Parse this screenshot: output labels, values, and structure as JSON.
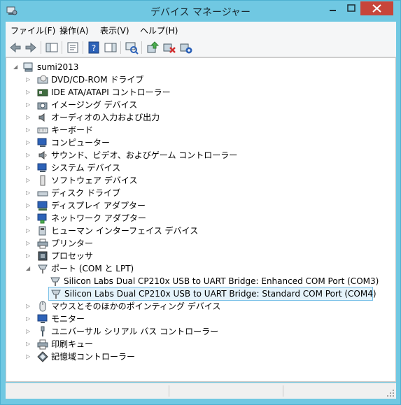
{
  "window": {
    "title": "デバイス マネージャー"
  },
  "menu": [
    {
      "label": "ファイル(F)"
    },
    {
      "label": "操作(A)"
    },
    {
      "label": "表示(V)"
    },
    {
      "label": "ヘルプ(H)"
    }
  ],
  "tree": {
    "root": "sumi2013",
    "categories": [
      {
        "label": "DVD/CD-ROM ドライブ",
        "icon": "dvd-drive-icon",
        "expanded": false
      },
      {
        "label": "IDE ATA/ATAPI コントローラー",
        "icon": "ide-controller-icon",
        "expanded": false
      },
      {
        "label": "イメージング デバイス",
        "icon": "camera-icon",
        "expanded": false
      },
      {
        "label": "オーディオの入力および出力",
        "icon": "speaker-icon",
        "expanded": false
      },
      {
        "label": "キーボード",
        "icon": "keyboard-icon",
        "expanded": false
      },
      {
        "label": "コンピューター",
        "icon": "computer-icon",
        "expanded": false
      },
      {
        "label": "サウンド、ビデオ、およびゲーム コントローラー",
        "icon": "sound-icon",
        "expanded": false
      },
      {
        "label": "システム デバイス",
        "icon": "system-icon",
        "expanded": false
      },
      {
        "label": "ソフトウェア デバイス",
        "icon": "software-icon",
        "expanded": false
      },
      {
        "label": "ディスク ドライブ",
        "icon": "disk-icon",
        "expanded": false
      },
      {
        "label": "ディスプレイ アダプター",
        "icon": "display-icon",
        "expanded": false
      },
      {
        "label": "ネットワーク アダプター",
        "icon": "network-icon",
        "expanded": false
      },
      {
        "label": "ヒューマン インターフェイス デバイス",
        "icon": "hid-icon",
        "expanded": false
      },
      {
        "label": "プリンター",
        "icon": "printer-icon",
        "expanded": false
      },
      {
        "label": "プロセッサ",
        "icon": "processor-icon",
        "expanded": false
      },
      {
        "label": "ポート (COM と LPT)",
        "icon": "port-icon",
        "expanded": true
      },
      {
        "label": "Silicon Labs Dual CP210x USB to UART Bridge: Enhanced COM Port (COM3)",
        "icon": "port-device-icon",
        "child": true
      },
      {
        "label": "Silicon Labs Dual CP210x USB to UART Bridge: Standard COM Port (COM4)",
        "icon": "port-device-icon",
        "child": true,
        "selected": true
      },
      {
        "label": "マウスとそのほかのポインティング デバイス",
        "icon": "mouse-icon",
        "expanded": false
      },
      {
        "label": "モニター",
        "icon": "monitor-icon",
        "expanded": false
      },
      {
        "label": "ユニバーサル シリアル バス コントローラー",
        "icon": "usb-icon",
        "expanded": false
      },
      {
        "label": "印刷キュー",
        "icon": "print-queue-icon",
        "expanded": false
      },
      {
        "label": "記憶域コントローラー",
        "icon": "storage-icon",
        "expanded": false
      }
    ]
  }
}
